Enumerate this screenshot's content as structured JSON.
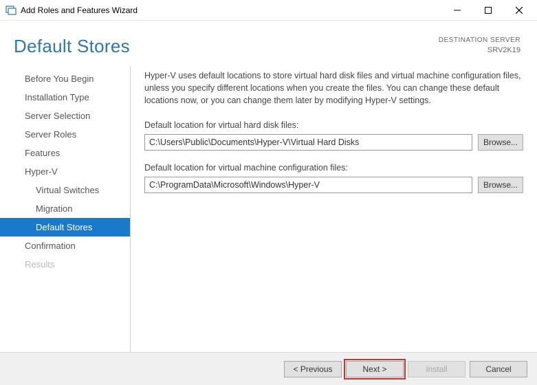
{
  "window": {
    "title": "Add Roles and Features Wizard"
  },
  "header": {
    "page_title": "Default Stores",
    "destination_label": "DESTINATION SERVER",
    "destination_value": "SRV2K19"
  },
  "sidebar": {
    "items": [
      {
        "label": "Before You Begin",
        "sub": false,
        "active": false,
        "disabled": false
      },
      {
        "label": "Installation Type",
        "sub": false,
        "active": false,
        "disabled": false
      },
      {
        "label": "Server Selection",
        "sub": false,
        "active": false,
        "disabled": false
      },
      {
        "label": "Server Roles",
        "sub": false,
        "active": false,
        "disabled": false
      },
      {
        "label": "Features",
        "sub": false,
        "active": false,
        "disabled": false
      },
      {
        "label": "Hyper-V",
        "sub": false,
        "active": false,
        "disabled": false
      },
      {
        "label": "Virtual Switches",
        "sub": true,
        "active": false,
        "disabled": false
      },
      {
        "label": "Migration",
        "sub": true,
        "active": false,
        "disabled": false
      },
      {
        "label": "Default Stores",
        "sub": true,
        "active": true,
        "disabled": false
      },
      {
        "label": "Confirmation",
        "sub": false,
        "active": false,
        "disabled": false
      },
      {
        "label": "Results",
        "sub": false,
        "active": false,
        "disabled": true
      }
    ]
  },
  "main": {
    "description": "Hyper-V uses default locations to store virtual hard disk files and virtual machine configuration files, unless you specify different locations when you create the files. You can change these default locations now, or you can change them later by modifying Hyper-V settings.",
    "field1_label": "Default location for virtual hard disk files:",
    "field1_value": "C:\\Users\\Public\\Documents\\Hyper-V\\Virtual Hard Disks",
    "field2_label": "Default location for virtual machine configuration files:",
    "field2_value": "C:\\ProgramData\\Microsoft\\Windows\\Hyper-V",
    "browse_label": "Browse..."
  },
  "footer": {
    "previous": "< Previous",
    "next": "Next >",
    "install": "Install",
    "cancel": "Cancel"
  }
}
